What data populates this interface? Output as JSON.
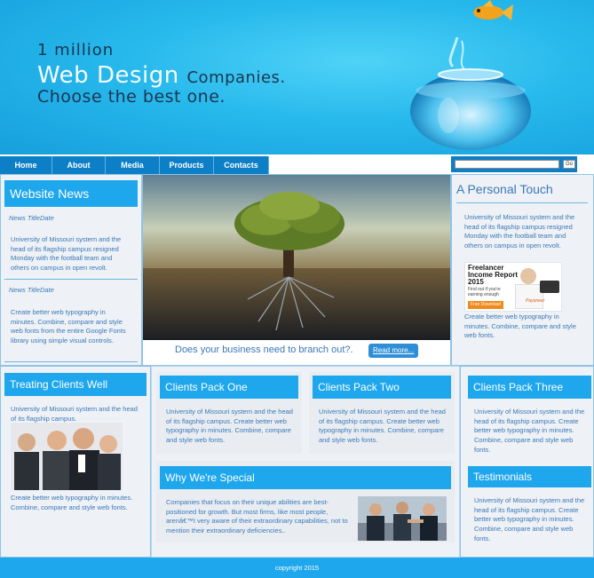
{
  "header": {
    "line1": "1 million",
    "line2_big": "Web Design",
    "line2_small": "Companies.",
    "line3": "Choose the best one."
  },
  "nav": {
    "items": [
      "Home",
      "About",
      "Media",
      "Products",
      "Contacts"
    ],
    "search_value": "",
    "search_button": "Go"
  },
  "website_news": {
    "title": "Website News",
    "items": [
      {
        "date": "News TitleDate",
        "text": "University of Missouri system and the head of its flagship campus resigned Monday with the football team and others on campus in open revolt."
      },
      {
        "date": "News TitleDate",
        "text": "Create better web typography in minutes. Combine, compare and style web fonts from the entire Google Fonts library using simple visual controls."
      }
    ]
  },
  "hero": {
    "caption": "Does your business need to branch out?.",
    "button": "Read more..."
  },
  "personal_touch": {
    "title": "A Personal Touch",
    "text1": "University of Missouri system and the head of its flagship campus resigned Monday with the football team and others on campus in open revolt.",
    "ad_title_1": "Freelancer",
    "ad_title_2": "Income Report",
    "ad_title_3": "2015",
    "ad_sub": "Find out if you're earning enough",
    "ad_button": "Free Download",
    "ad_brand": "Payoneer",
    "text2": "Create better web typography in minutes. Combine, compare and style web fonts."
  },
  "treating_clients": {
    "title": "Treating Clients Well",
    "text1": "University of Missouri system and the head of its flagship campus.",
    "text2": "Create better web typography in minutes. Combine, compare and style web fonts."
  },
  "packs": [
    {
      "title": "Clients Pack One",
      "text": "University of Missouri system and the head of its flagship campus. Create better web typography in minutes. Combine, compare and style web fonts."
    },
    {
      "title": "Clients Pack Two",
      "text": "University of Missouri system and the head of its flagship campus. Create better web typography in minutes. Combine, compare and style web fonts."
    },
    {
      "title": "Clients Pack Three",
      "text": "University of Missouri system and the head of its flagship campus. Create better web typography in minutes. Combine, compare and style web fonts."
    }
  ],
  "special": {
    "title": "Why We're Special",
    "text": "Companies that focus on their unique abilities are best-positioned for growth. But most firms, like most people, arenâ€™t very aware of their extraordinary capabilities, not to mention their extraordinary deficiencies.."
  },
  "testimonials": {
    "title": "Testimonials",
    "text": "University of Missouri system and the head of its flagship campus. Create better web typography in minutes. Combine, compare and style web fonts."
  },
  "footer": {
    "text": "copyright 2015"
  },
  "colors": {
    "accent": "#1ea7ec",
    "nav": "#0d7fc7",
    "text": "#3a78b8"
  }
}
